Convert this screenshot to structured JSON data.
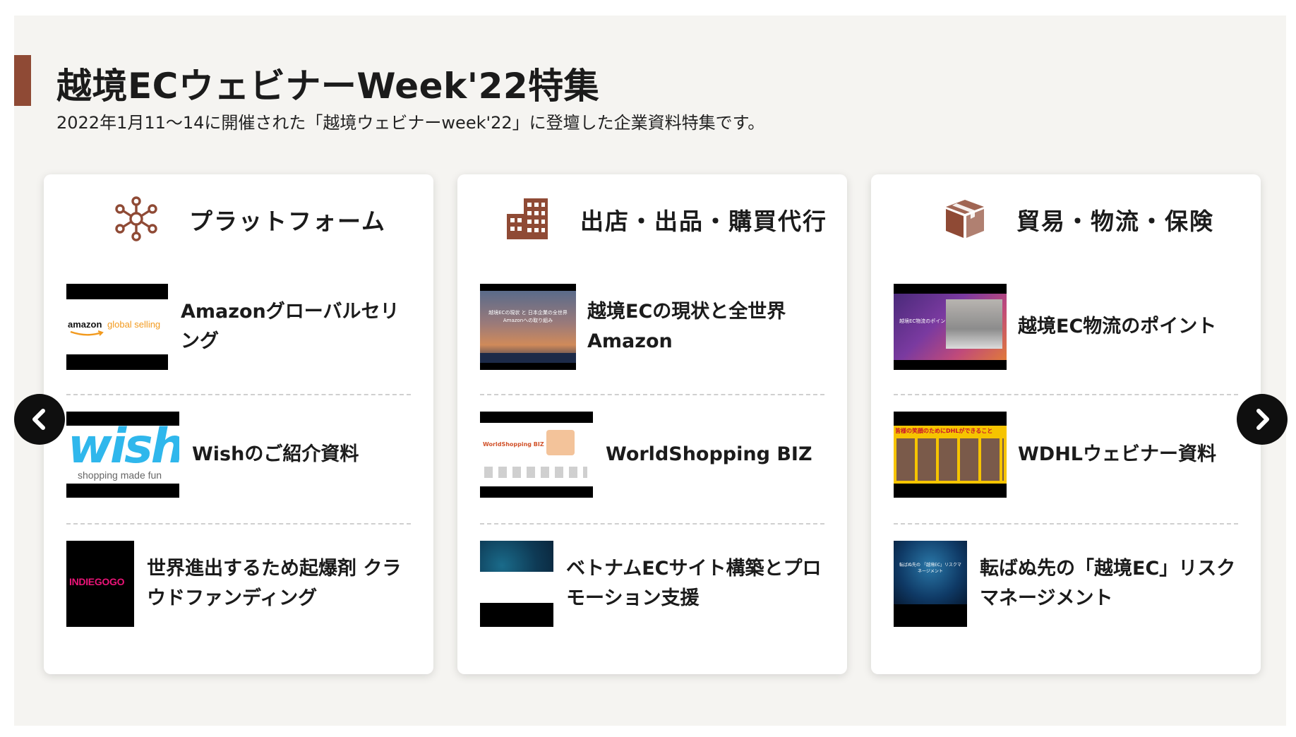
{
  "section": {
    "title": "越境ECウェビナーWeek'22特集",
    "subtitle": "2022年1月11〜14に開催された「越境ウェビナーweek'22」に登壇した企業資料特集です。",
    "accent_color": "#8f4a35"
  },
  "carousel": {
    "prev_icon": "chevron-left-icon",
    "next_icon": "chevron-right-icon"
  },
  "categories": [
    {
      "title": "プラットフォーム",
      "icon": "network-nodes-icon",
      "items": [
        {
          "title": "Amazonグローバルセリング",
          "thumb_brand": "amazon",
          "thumb_brand_accent": "global selling"
        },
        {
          "title": "Wishのご紹介資料",
          "thumb_brand": "wish",
          "thumb_tagline": "shopping made fun"
        },
        {
          "title": "世界進出するため起爆剤 クラウドファンディング",
          "thumb_brand": "INDIEGOGO"
        }
      ]
    },
    {
      "title": "出店・出品・購買代行",
      "icon": "building-icon",
      "items": [
        {
          "title": "越境ECの現状と全世界Amazon",
          "thumb_text": "越境ECの現状 と 日本企業の全世界Amazonへの取り組み"
        },
        {
          "title": "WorldShopping BIZ",
          "thumb_text": "WorldShopping BIZ"
        },
        {
          "title": "ベトナムECサイト構築とプロモーション支援"
        }
      ]
    },
    {
      "title": "貿易・物流・保険",
      "icon": "package-box-icon",
      "items": [
        {
          "title": "越境EC物流のポイント",
          "thumb_text": "越境EC物流のポイント"
        },
        {
          "title": "WDHLウェビナー資料",
          "thumb_text": "皆様の笑顔のためにDHLができること"
        },
        {
          "title": "転ばぬ先の「越境EC」リスクマネージメント",
          "thumb_text": "転ばぬ先の 「越境EC」リスクマネージメント"
        }
      ]
    }
  ]
}
